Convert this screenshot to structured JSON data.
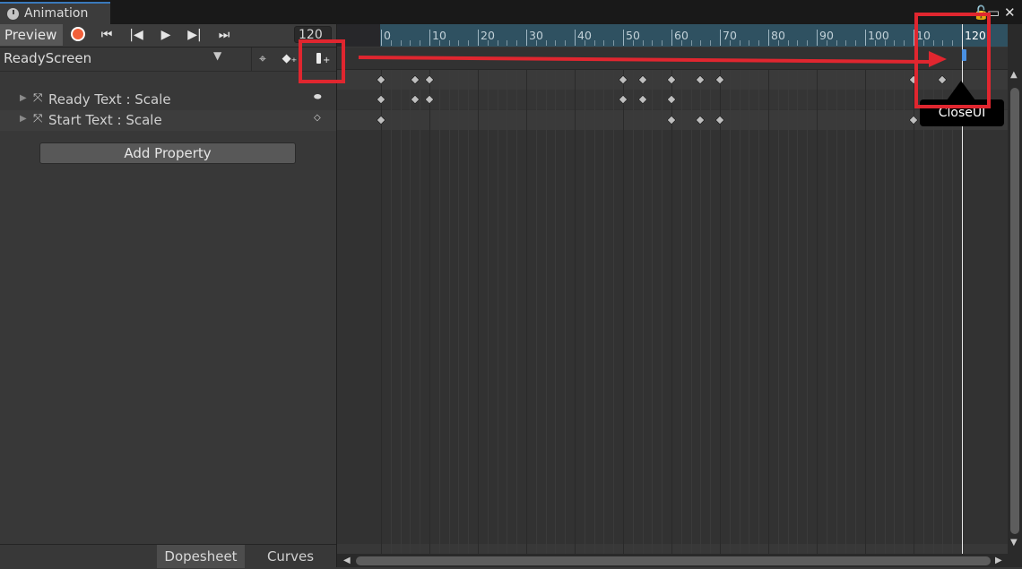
{
  "window": {
    "tab_title": "Animation",
    "controls": {
      "lock": "🔓",
      "maximize": "▭",
      "close": "✕"
    }
  },
  "toolbar": {
    "preview_label": "Preview",
    "first_frame": "⏮",
    "prev_key": "⏮",
    "play": "▶",
    "next_key": "⏭",
    "last_frame": "⏭",
    "frame_value": "120"
  },
  "clip": {
    "name": "ReadyScreen"
  },
  "properties": [
    {
      "label": "Ready Text : Scale",
      "right_icon": "⬬"
    },
    {
      "label": "Start Text : Scale",
      "right_icon": "◇"
    }
  ],
  "add_property_label": "Add Property",
  "bottom_tabs": {
    "dopesheet": "Dopesheet",
    "curves": "Curves"
  },
  "timeline": {
    "ruler_labels": [
      "0",
      "10",
      "20",
      "30",
      "40",
      "50",
      "60",
      "70",
      "80",
      "90",
      "100",
      "110",
      "120"
    ],
    "visible_ruler_labels": [
      "0",
      "10",
      "20",
      "30",
      "40",
      "50",
      "60",
      "70",
      "80",
      "90",
      "100",
      "10",
      "120"
    ],
    "playhead_frame": 120,
    "event_marker_frame": 120,
    "keyframes": {
      "summary": [
        0,
        7,
        10,
        50,
        54,
        60,
        66,
        70,
        110,
        116
      ],
      "ready_text_scale": [
        0,
        7,
        10,
        50,
        54,
        60
      ],
      "start_text_scale": [
        0,
        60,
        66,
        70,
        110
      ]
    }
  },
  "tooltip": {
    "text": "CloseUI"
  },
  "annotation_color": "#e0262f",
  "accent_color": "#4a90e2"
}
